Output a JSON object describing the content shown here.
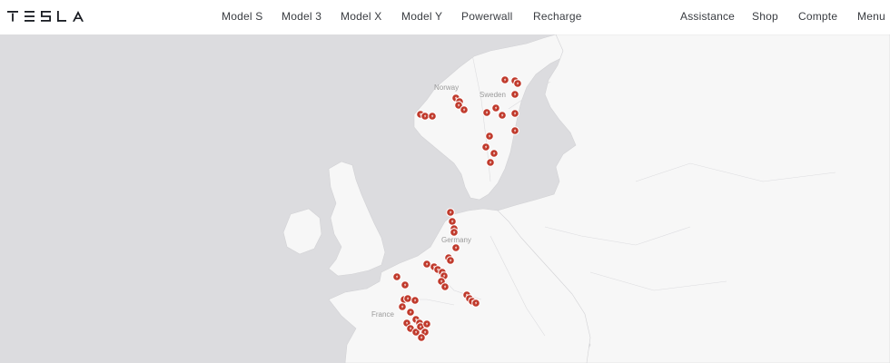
{
  "brand": {
    "name": "Tesla"
  },
  "nav": {
    "primary": [
      "Model S",
      "Model 3",
      "Model X",
      "Model Y",
      "Powerwall",
      "Recharge"
    ],
    "secondary": [
      "Assistance",
      "Shop",
      "Compte",
      "Menu"
    ]
  },
  "map": {
    "labels": {
      "norway": "Norway",
      "sweden": "Sweden",
      "germany": "Germany",
      "france": "France"
    },
    "colors": {
      "water": "#dcdcdf",
      "land": "#f7f7f7",
      "border": "#cfcfd2",
      "pin": "#c0392b"
    },
    "pin_icon": "charging-station-pin"
  }
}
